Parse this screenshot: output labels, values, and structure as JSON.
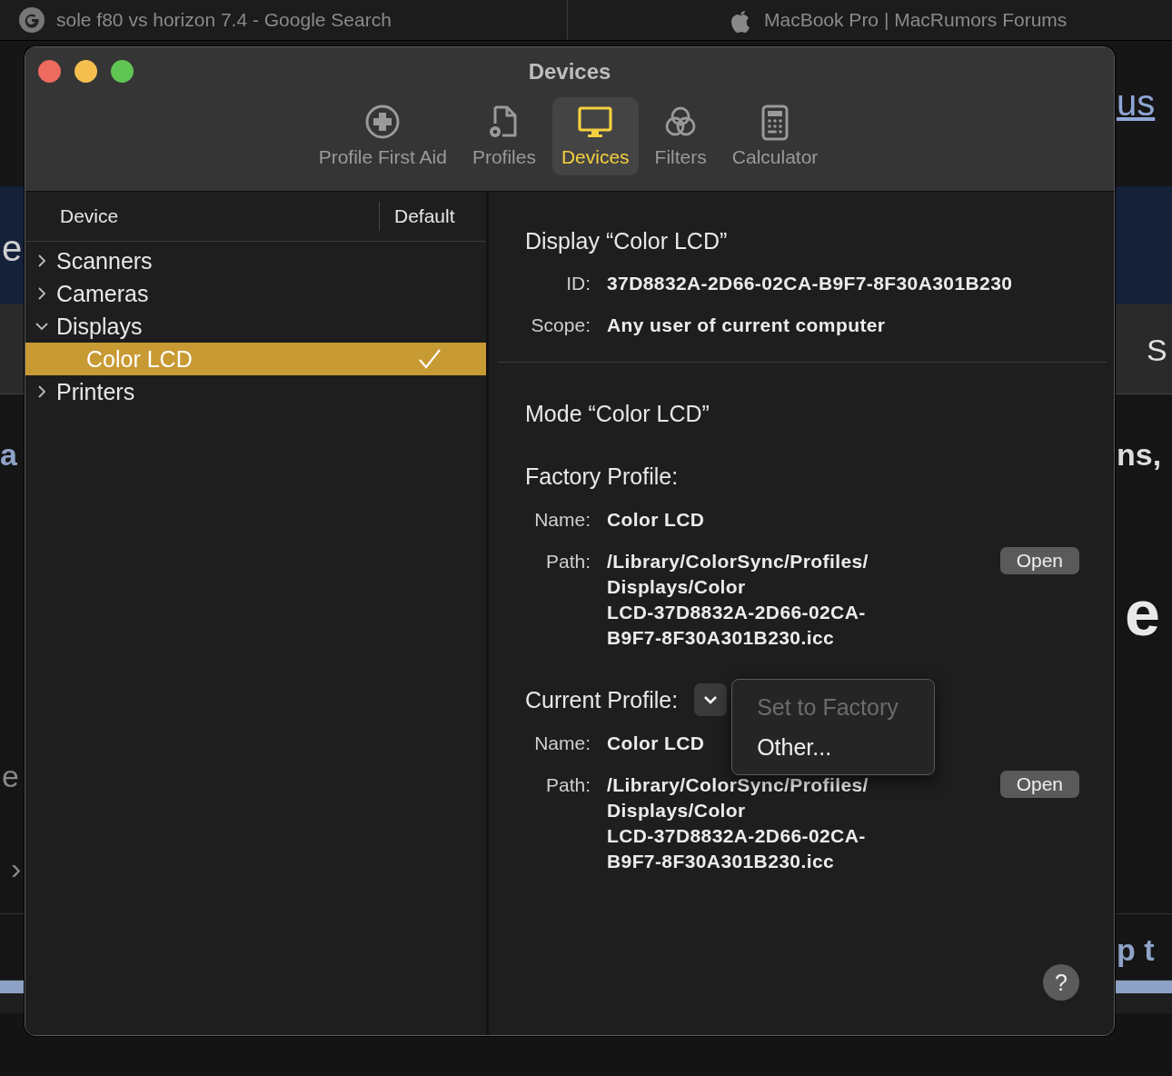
{
  "browser_tabs": [
    {
      "title": "sole f80 vs horizon 7.4 - Google Search"
    },
    {
      "title": "MacBook Pro | MacRumors Forums"
    }
  ],
  "background_fragments": [
    {
      "text": "us",
      "kind": "link"
    },
    {
      "text": "e",
      "kind": "heading"
    },
    {
      "text": "S",
      "kind": "plain"
    },
    {
      "text": "a",
      "kind": "accent"
    },
    {
      "text": "ns,",
      "kind": "bold"
    },
    {
      "text": "e",
      "kind": "big"
    },
    {
      "text": "e",
      "kind": "muted"
    },
    {
      "text": "›",
      "kind": "muted"
    },
    {
      "text": "p t",
      "kind": "accent"
    }
  ],
  "window": {
    "title": "Devices",
    "toolbar": [
      {
        "label": "Profile First Aid",
        "selected": false
      },
      {
        "label": "Profiles",
        "selected": false
      },
      {
        "label": "Devices",
        "selected": true
      },
      {
        "label": "Filters",
        "selected": false
      },
      {
        "label": "Calculator",
        "selected": false
      }
    ],
    "device_list": {
      "columns": [
        "Device",
        "Default"
      ],
      "items": [
        {
          "label": "Scanners",
          "expanded": false,
          "selected": false
        },
        {
          "label": "Cameras",
          "expanded": false,
          "selected": false
        },
        {
          "label": "Displays",
          "expanded": true,
          "selected": false,
          "children": [
            {
              "label": "Color LCD",
              "selected": true,
              "default": true
            }
          ]
        },
        {
          "label": "Printers",
          "expanded": false,
          "selected": false
        }
      ]
    },
    "display": {
      "heading": "Display “Color LCD”",
      "fields": [
        {
          "label": "ID:",
          "value": "37D8832A-2D66-02CA-B9F7-8F30A301B230"
        },
        {
          "label": "Scope:",
          "value": "Any user of current computer"
        }
      ]
    },
    "mode": {
      "heading": "Mode “Color LCD”",
      "factory_profile": {
        "heading": "Factory Profile:",
        "name_label": "Name:",
        "name": "Color LCD",
        "path_label": "Path:",
        "path_lines": [
          "/Library/ColorSync/Profiles/",
          "Displays/Color",
          "LCD-37D8832A-2D66-02CA-",
          "B9F7-8F30A301B230.icc"
        ],
        "button": "Open"
      },
      "current_profile": {
        "heading": "Current Profile:",
        "name_label": "Name:",
        "name": "Color LCD",
        "path_label": "Path:",
        "path_lines": [
          "/Library/ColorSync/Profiles/",
          "Displays/Color",
          "LCD-37D8832A-2D66-02CA-",
          "B9F7-8F30A301B230.icc"
        ],
        "button": "Open",
        "menu": [
          {
            "label": "Set to Factory",
            "disabled": true
          },
          {
            "label": "Other...",
            "disabled": false
          }
        ]
      }
    },
    "help_button": "?"
  }
}
